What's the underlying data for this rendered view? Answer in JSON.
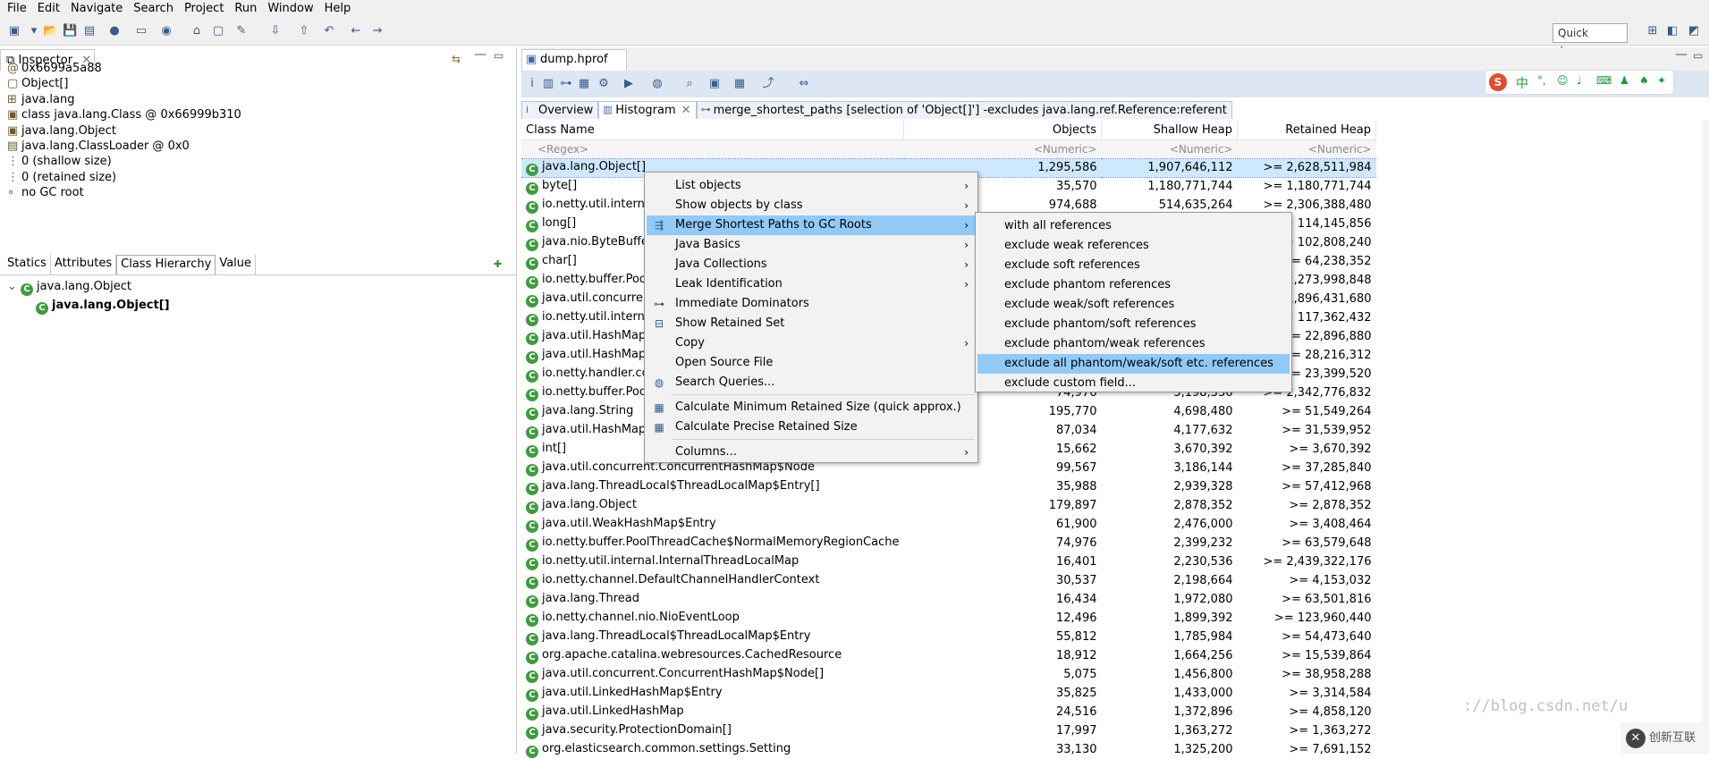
{
  "menubar": [
    "File",
    "Edit",
    "Navigate",
    "Search",
    "Project",
    "Run",
    "Window",
    "Help"
  ],
  "toolbar": {
    "quick_access": "Quick Access"
  },
  "inspector": {
    "tab_label": "Inspector",
    "lines": [
      {
        "icon": "address-icon",
        "text": "0x6699a5a88"
      },
      {
        "icon": "array-icon",
        "text": "Object[]"
      },
      {
        "icon": "package-icon",
        "text": "java.lang"
      },
      {
        "icon": "class-icon",
        "text": "class java.lang.Class @ 0x66999b310"
      },
      {
        "icon": "class-icon",
        "text": "java.lang.Object"
      },
      {
        "icon": "classloader-icon",
        "text": "java.lang.ClassLoader @ 0x0"
      },
      {
        "icon": "size-icon",
        "text": "0 (shallow size)"
      },
      {
        "icon": "size-icon",
        "text": "0 (retained size)"
      },
      {
        "icon": "gc-icon",
        "text": "no GC root"
      }
    ],
    "attr_tabs": [
      "Statics",
      "Attributes",
      "Class Hierarchy",
      "Value"
    ],
    "hierarchy": [
      "java.lang.Object",
      "java.lang.Object[]"
    ]
  },
  "editor": {
    "file_tab": "dump.hprof",
    "sub_tabs": [
      "Overview",
      "Histogram",
      "merge_shortest_paths [selection of 'Object[]'] -excludes java.lang.ref.Reference:referent"
    ]
  },
  "histogram": {
    "columns": [
      "Class Name",
      "Objects",
      "Shallow Heap",
      "Retained Heap"
    ],
    "filter": [
      "<Regex>",
      "<Numeric>",
      "<Numeric>",
      "<Numeric>"
    ],
    "rows": [
      [
        "java.lang.Object[]",
        "1,295,586",
        "1,907,646,112",
        ">= 2,628,511,984"
      ],
      [
        "byte[]",
        "35,570",
        "1,180,771,744",
        ">= 1,180,771,744"
      ],
      [
        "io.netty.util.internal.",
        "974,688",
        "514,635,264",
        ">= 2,306,388,480"
      ],
      [
        "long[]",
        "",
        "",
        ">= 114,145,856"
      ],
      [
        "java.nio.ByteBuffer[]",
        "",
        "",
        ">= 102,808,240"
      ],
      [
        "char[]",
        "",
        "",
        ">= 64,238,352"
      ],
      [
        "io.netty.buffer.PoolT",
        "",
        "",
        ">= 2,273,998,848"
      ],
      [
        "java.util.concurrent.",
        "",
        "",
        ">= 1,896,431,680"
      ],
      [
        "io.netty.util.internal.",
        "",
        "",
        ">= 117,362,432"
      ],
      [
        "java.util.HashMap$N",
        "",
        "",
        ">= 22,896,880"
      ],
      [
        "java.util.HashMap$N",
        "",
        "",
        ">= 28,216,312"
      ],
      [
        "io.netty.handler.cod",
        "",
        "",
        ">= 23,399,520"
      ],
      [
        "io.netty.buffer.PoolT",
        "74,976",
        "5,198,336",
        ">= 2,342,776,832"
      ],
      [
        "java.lang.String",
        "195,770",
        "4,698,480",
        ">= 51,549,264"
      ],
      [
        "java.util.HashMap",
        "87,034",
        "4,177,632",
        ">= 31,539,952"
      ],
      [
        "int[]",
        "15,662",
        "3,670,392",
        ">= 3,670,392"
      ],
      [
        "java.util.concurrent.ConcurrentHashMap$Node",
        "99,567",
        "3,186,144",
        ">= 37,285,840"
      ],
      [
        "java.lang.ThreadLocal$ThreadLocalMap$Entry[]",
        "35,988",
        "2,939,328",
        ">= 57,412,968"
      ],
      [
        "java.lang.Object",
        "179,897",
        "2,878,352",
        ">= 2,878,352"
      ],
      [
        "java.util.WeakHashMap$Entry",
        "61,900",
        "2,476,000",
        ">= 3,408,464"
      ],
      [
        "io.netty.buffer.PoolThreadCache$NormalMemoryRegionCache",
        "74,976",
        "2,399,232",
        ">= 63,579,648"
      ],
      [
        "io.netty.util.internal.InternalThreadLocalMap",
        "16,401",
        "2,230,536",
        ">= 2,439,322,176"
      ],
      [
        "io.netty.channel.DefaultChannelHandlerContext",
        "30,537",
        "2,198,664",
        ">= 4,153,032"
      ],
      [
        "java.lang.Thread",
        "16,434",
        "1,972,080",
        ">= 63,501,816"
      ],
      [
        "io.netty.channel.nio.NioEventLoop",
        "12,496",
        "1,899,392",
        ">= 123,960,440"
      ],
      [
        "java.lang.ThreadLocal$ThreadLocalMap$Entry",
        "55,812",
        "1,785,984",
        ">= 54,473,640"
      ],
      [
        "org.apache.catalina.webresources.CachedResource",
        "18,912",
        "1,664,256",
        ">= 15,539,864"
      ],
      [
        "java.util.concurrent.ConcurrentHashMap$Node[]",
        "5,075",
        "1,456,800",
        ">= 38,958,288"
      ],
      [
        "java.util.LinkedHashMap$Entry",
        "35,825",
        "1,433,000",
        ">= 3,314,584"
      ],
      [
        "java.util.LinkedHashMap",
        "24,516",
        "1,372,896",
        ">= 4,858,120"
      ],
      [
        "java.security.ProtectionDomain[]",
        "17,997",
        "1,363,272",
        ">= 1,363,272"
      ],
      [
        "org.elasticsearch.common.settings.Setting",
        "33,130",
        "1,325,200",
        ">= 7,691,152"
      ]
    ]
  },
  "context_menu": [
    {
      "label": "List objects",
      "sub": true,
      "icon": ""
    },
    {
      "label": "Show objects by class",
      "sub": true,
      "icon": ""
    },
    {
      "label": "Merge Shortest Paths to GC Roots",
      "sub": true,
      "icon": "merge-paths-icon"
    },
    {
      "label": "Java Basics",
      "sub": true,
      "icon": ""
    },
    {
      "label": "Java Collections",
      "sub": true,
      "icon": ""
    },
    {
      "label": "Leak Identification",
      "sub": true,
      "icon": ""
    },
    {
      "label": "Immediate Dominators",
      "sub": false,
      "icon": "dominators-icon"
    },
    {
      "label": "Show Retained Set",
      "sub": false,
      "icon": "retained-set-icon"
    },
    {
      "label": "Copy",
      "sub": true,
      "icon": ""
    },
    {
      "label": "Open Source File",
      "sub": false,
      "icon": ""
    },
    {
      "label": "Search Queries...",
      "sub": false,
      "icon": "search-queries-icon"
    },
    {
      "label": "Calculate Minimum Retained Size (quick approx.)",
      "sub": false,
      "icon": "calculator-icon"
    },
    {
      "label": "Calculate Precise Retained Size",
      "sub": false,
      "icon": "calculator-icon"
    },
    {
      "label": "Columns...",
      "sub": true,
      "icon": ""
    }
  ],
  "submenu": [
    "with all references",
    "exclude weak references",
    "exclude soft references",
    "exclude phantom references",
    "exclude weak/soft references",
    "exclude phantom/soft references",
    "exclude phantom/weak references",
    "exclude all phantom/weak/soft etc. references",
    "exclude custom field..."
  ],
  "watermark": "://blog.csdn.net/u",
  "logo_text": "创新互联"
}
